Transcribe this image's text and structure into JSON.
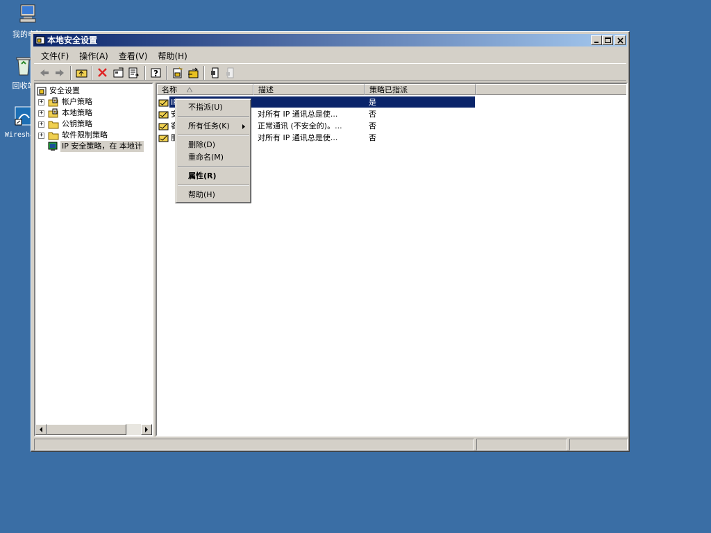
{
  "desktop": {
    "icons": [
      {
        "label": "我的电脑",
        "icon": "my-computer-icon"
      },
      {
        "label": "回收站",
        "icon": "recycle-bin-icon"
      },
      {
        "label": "Wireshark",
        "icon": "wireshark-shortcut-icon"
      }
    ],
    "background_color": "#3a6ea5"
  },
  "window": {
    "title": "本地安全设置",
    "controls": [
      "minimize",
      "maximize",
      "close"
    ]
  },
  "menubar": {
    "items": [
      "文件(F)",
      "操作(A)",
      "查看(V)",
      "帮助(H)"
    ]
  },
  "toolbar": {
    "icons": [
      "back-icon",
      "forward-icon",
      "up-folder-icon",
      "delete-icon",
      "properties-icon",
      "export-list-icon",
      "help-icon",
      "new-policy-icon",
      "manage-filters-icon",
      "assign-icon",
      "unassign-icon"
    ]
  },
  "tree": {
    "items": [
      {
        "label": "安全设置",
        "icon": "security-settings-icon"
      },
      {
        "label": "帐户策略",
        "icon": "folder-lock-icon"
      },
      {
        "label": "本地策略",
        "icon": "folder-lock-icon"
      },
      {
        "label": "公钥策略",
        "icon": "folder-icon"
      },
      {
        "label": "软件限制策略",
        "icon": "folder-icon"
      },
      {
        "label": "IP 安全策略，在 本地计",
        "icon": "ip-security-icon"
      }
    ]
  },
  "list": {
    "columns": [
      "名称",
      "描述",
      "策略已指派"
    ],
    "rows": [
      {
        "name": "IP...",
        "description": "",
        "assigned": "是"
      },
      {
        "name": "安...",
        "description": "对所有 IP 通讯总是使...",
        "assigned": "否"
      },
      {
        "name": "客...",
        "description": "正常通讯 (不安全的)。...",
        "assigned": "否"
      },
      {
        "name": "服...",
        "description": "对所有 IP 通讯总是使...",
        "assigned": "否"
      }
    ]
  },
  "context_menu": {
    "items": [
      "不指派(U)",
      "所有任务(K)",
      "删除(D)",
      "重命名(M)",
      "属性(R)",
      "帮助(H)"
    ]
  }
}
